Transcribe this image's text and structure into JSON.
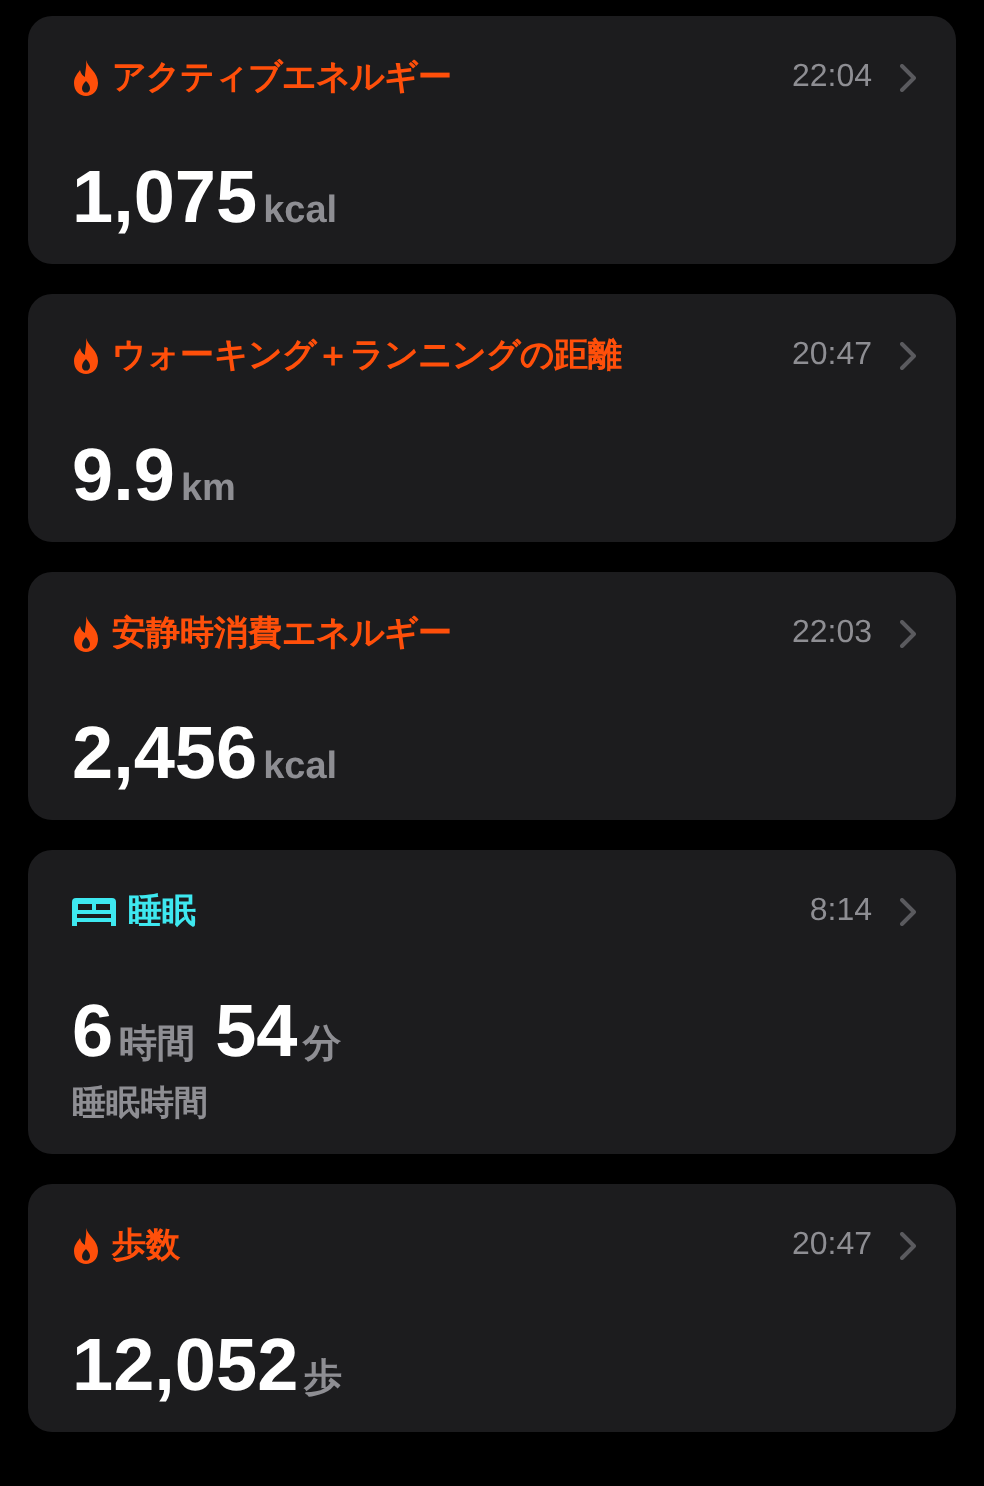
{
  "cards": [
    {
      "kind": "flame",
      "color": "#ff4f0a",
      "title": "アクティブエネルギー",
      "time": "22:04",
      "values": [
        {
          "number": "1,075",
          "unit": "kcal"
        }
      ]
    },
    {
      "kind": "flame",
      "color": "#ff4f0a",
      "title": "ウォーキング＋ランニングの距離",
      "time": "20:47",
      "values": [
        {
          "number": "9.9",
          "unit": "km"
        }
      ]
    },
    {
      "kind": "flame",
      "color": "#ff4f0a",
      "title": "安静時消費エネルギー",
      "time": "22:03",
      "values": [
        {
          "number": "2,456",
          "unit": "kcal"
        }
      ]
    },
    {
      "kind": "bed",
      "color": "#3ee8f0",
      "title": "睡眠",
      "time": "8:14",
      "values": [
        {
          "number": "6",
          "unit": "時間"
        },
        {
          "number": "54",
          "unit": "分"
        }
      ],
      "subtitle": "睡眠時間"
    },
    {
      "kind": "flame",
      "color": "#ff4f0a",
      "title": "歩数",
      "time": "20:47",
      "values": [
        {
          "number": "12,052",
          "unit": "歩"
        }
      ]
    }
  ]
}
